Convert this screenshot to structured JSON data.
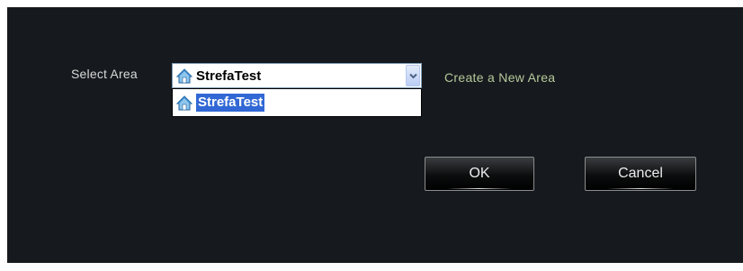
{
  "dialog": {
    "select_area_label": "Select Area",
    "combo": {
      "selected_value": "StrefaTest",
      "icon": "home-icon"
    },
    "dropdown": {
      "options": [
        "StrefaTest"
      ],
      "highlighted_index": 0
    },
    "create_link": "Create a New Area",
    "ok_label": "OK",
    "cancel_label": "Cancel"
  },
  "colors": {
    "background": "#161a1e",
    "link": "#b7c89a",
    "highlight": "#3168d5"
  }
}
